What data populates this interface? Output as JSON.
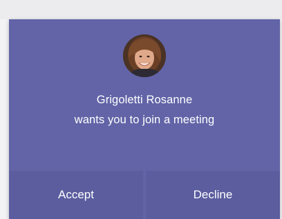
{
  "notification": {
    "caller_name": "Grigoletti Rosanne",
    "message": "wants you to join a meeting",
    "avatar_icon": "person-photo",
    "background_color": "#6264a7",
    "button_color": "#5b5d9f"
  },
  "actions": {
    "accept_label": "Accept",
    "decline_label": "Decline"
  }
}
